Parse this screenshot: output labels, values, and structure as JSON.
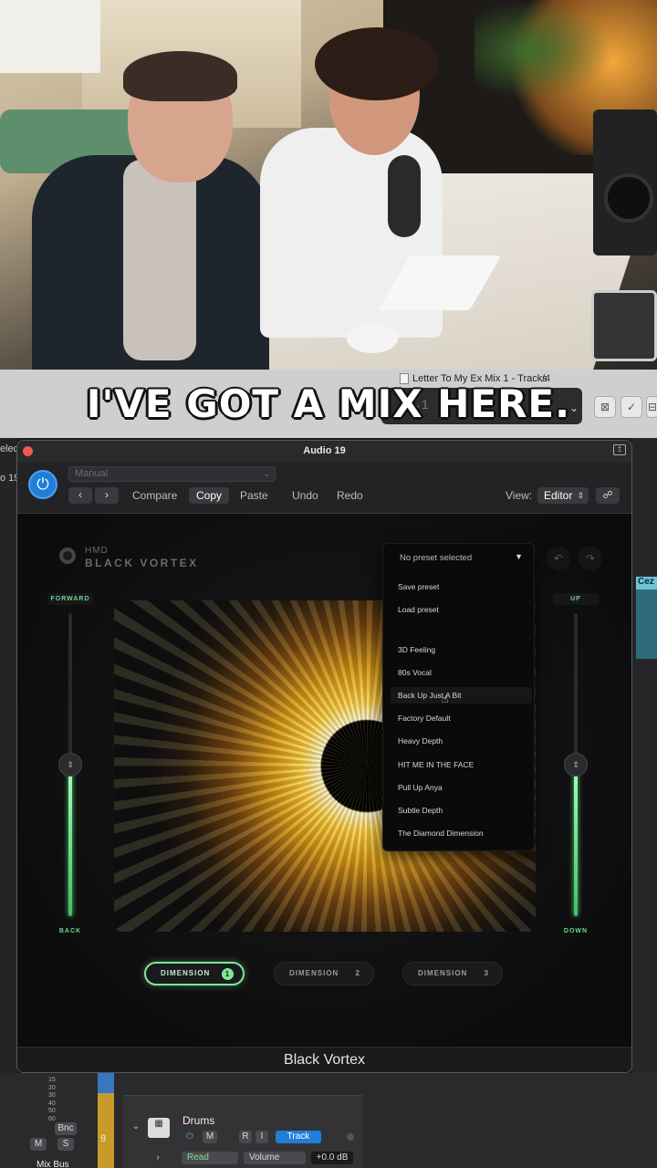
{
  "caption": "I'VE GOT A MIX HERE.",
  "daw": {
    "project_title": "Letter To My Ex Mix 1 - Tracks",
    "left_text_1": "elec",
    "left_text_2": "o 19",
    "region_label": "Cez",
    "lcd_fragment_1": "→1",
    "lcd_fragment_2": "/4"
  },
  "plugin": {
    "window_title": "Audio 19",
    "toolbar": {
      "preset_value": "Manual",
      "back_glyph": "‹",
      "fwd_glyph": "›",
      "compare": "Compare",
      "copy": "Copy",
      "paste": "Paste",
      "undo": "Undo",
      "redo": "Redo",
      "view_label": "View:",
      "view_value": "Editor"
    },
    "brand_line1": "HMD",
    "brand_line2": "BLACK VORTEX",
    "left_slider": {
      "top_label": "FORWARD",
      "bottom_label": "BACK",
      "level": 0.5
    },
    "right_slider": {
      "top_label": "UP",
      "bottom_label": "DOWN",
      "level": 0.5
    },
    "preset_menu": {
      "header": "No preset selected",
      "actions": [
        "Save preset",
        "Load preset"
      ],
      "presets": [
        "3D Feeling",
        "80s Vocal",
        "Back Up Just A Bit",
        "Factory Default",
        "Heavy Depth",
        "HIT ME IN THE FACE",
        "Pull Up Anya",
        "Subtle Depth",
        "The Diamond Dimension"
      ],
      "highlighted": "Back Up Just A Bit"
    },
    "dimensions": [
      {
        "label": "DIMENSION",
        "num": "1",
        "active": true
      },
      {
        "label": "DIMENSION",
        "num": "2",
        "active": false
      },
      {
        "label": "DIMENSION",
        "num": "3",
        "active": false
      }
    ],
    "footer_title": "Black Vortex"
  },
  "track": {
    "name": "Drums",
    "number": "9",
    "m": "M",
    "r": "R",
    "i": "I",
    "track_btn": "Track",
    "automation_mode": "Read",
    "automation_param": "Volume",
    "gain": "+0.0 dB",
    "bnc": "Bnc",
    "mute": "M",
    "solo": "S",
    "bus": "Mix Bus",
    "meter_scale": [
      "15",
      "20",
      "30",
      "40",
      "50",
      "60"
    ]
  },
  "colors": {
    "accent_green": "#7ee895",
    "power_blue": "#1f7fd8"
  }
}
